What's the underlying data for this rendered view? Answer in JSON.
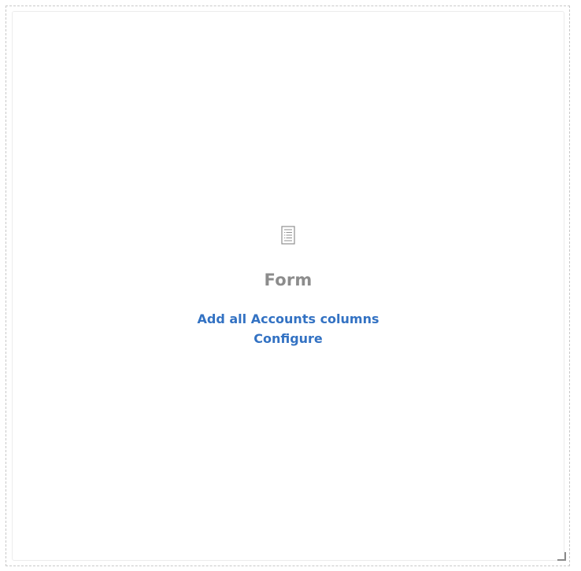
{
  "widget": {
    "title": "Form",
    "icon": "form-icon",
    "actions": {
      "add_columns_label": "Add all Accounts columns",
      "configure_label": "Configure"
    },
    "colors": {
      "link": "#3372c3",
      "title": "#8c8c8c",
      "border": "#c8c8c8"
    }
  }
}
